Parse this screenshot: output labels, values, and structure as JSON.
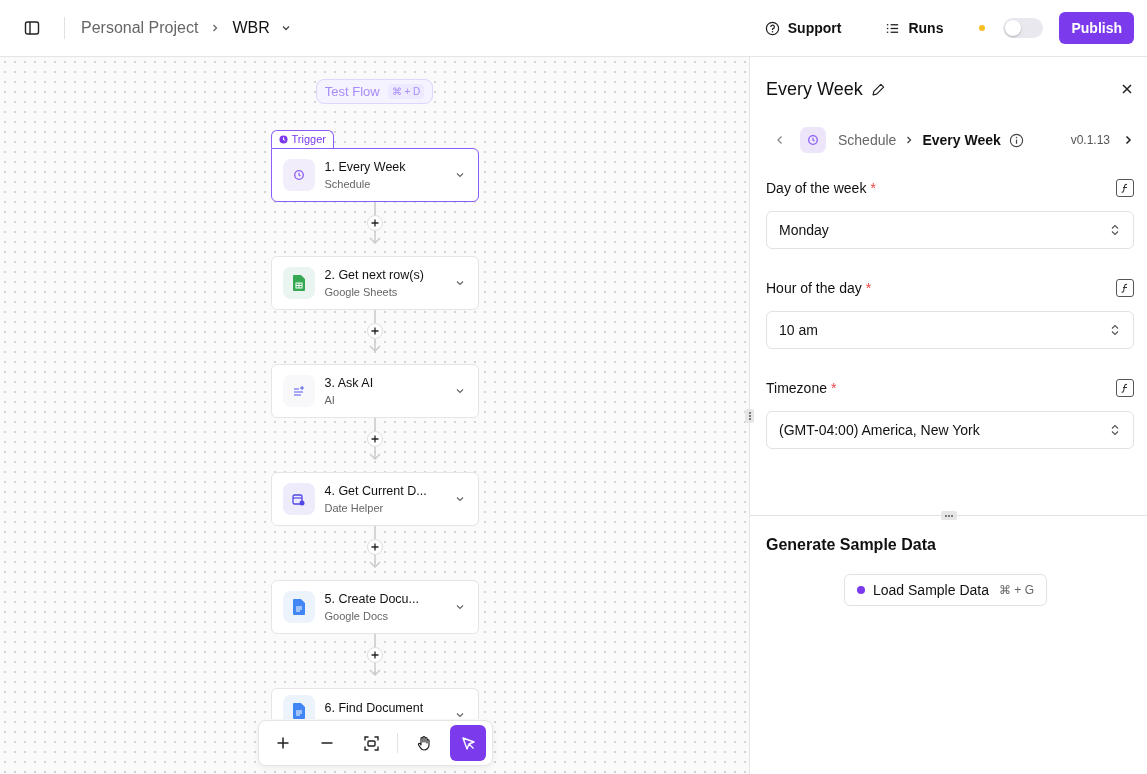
{
  "header": {
    "breadcrumb": [
      "Personal Project",
      "WBR"
    ],
    "support": "Support",
    "runs": "Runs",
    "toggle": {
      "on": false
    },
    "publish": "Publish"
  },
  "canvas": {
    "test_flow": {
      "label": "Test Flow",
      "shortcut": "⌘ + D"
    },
    "trigger_label": "Trigger",
    "steps": [
      {
        "kind": "schedule",
        "title": "1. Every Week",
        "subtitle": "Schedule",
        "selected": true
      },
      {
        "kind": "sheets",
        "title": "2. Get next row(s)",
        "subtitle": "Google Sheets",
        "selected": false
      },
      {
        "kind": "ai",
        "title": "3. Ask AI",
        "subtitle": "AI",
        "selected": false
      },
      {
        "kind": "date",
        "title": "4. Get Current D...",
        "subtitle": "Date Helper",
        "selected": false
      },
      {
        "kind": "docs",
        "title": "5. Create Docu...",
        "subtitle": "Google Docs",
        "selected": false
      },
      {
        "kind": "docs",
        "title": "6. Find Document",
        "selected": false
      }
    ],
    "toolbar": [
      {
        "kind": "zoom-in",
        "selected": false
      },
      {
        "kind": "zoom-out",
        "selected": false
      },
      {
        "kind": "fit",
        "selected": false
      },
      {
        "kind": "hand",
        "selected": false
      },
      {
        "kind": "pointer",
        "selected": true
      }
    ]
  },
  "panel": {
    "title": "Every Week",
    "breadcrumb": [
      "Schedule",
      "Every Week"
    ],
    "version": "v0.1.13",
    "fields": [
      {
        "label": "Day of the week",
        "required_mark": "*",
        "value": "Monday"
      },
      {
        "label": "Hour of the day",
        "required_mark": "*",
        "value": "10 am"
      },
      {
        "label": "Timezone",
        "required_mark": "*",
        "value": "(GMT-04:00) America, New York"
      }
    ],
    "sample": {
      "title": "Generate Sample Data",
      "button": "Load Sample Data",
      "shortcut": "⌘ + G"
    }
  }
}
